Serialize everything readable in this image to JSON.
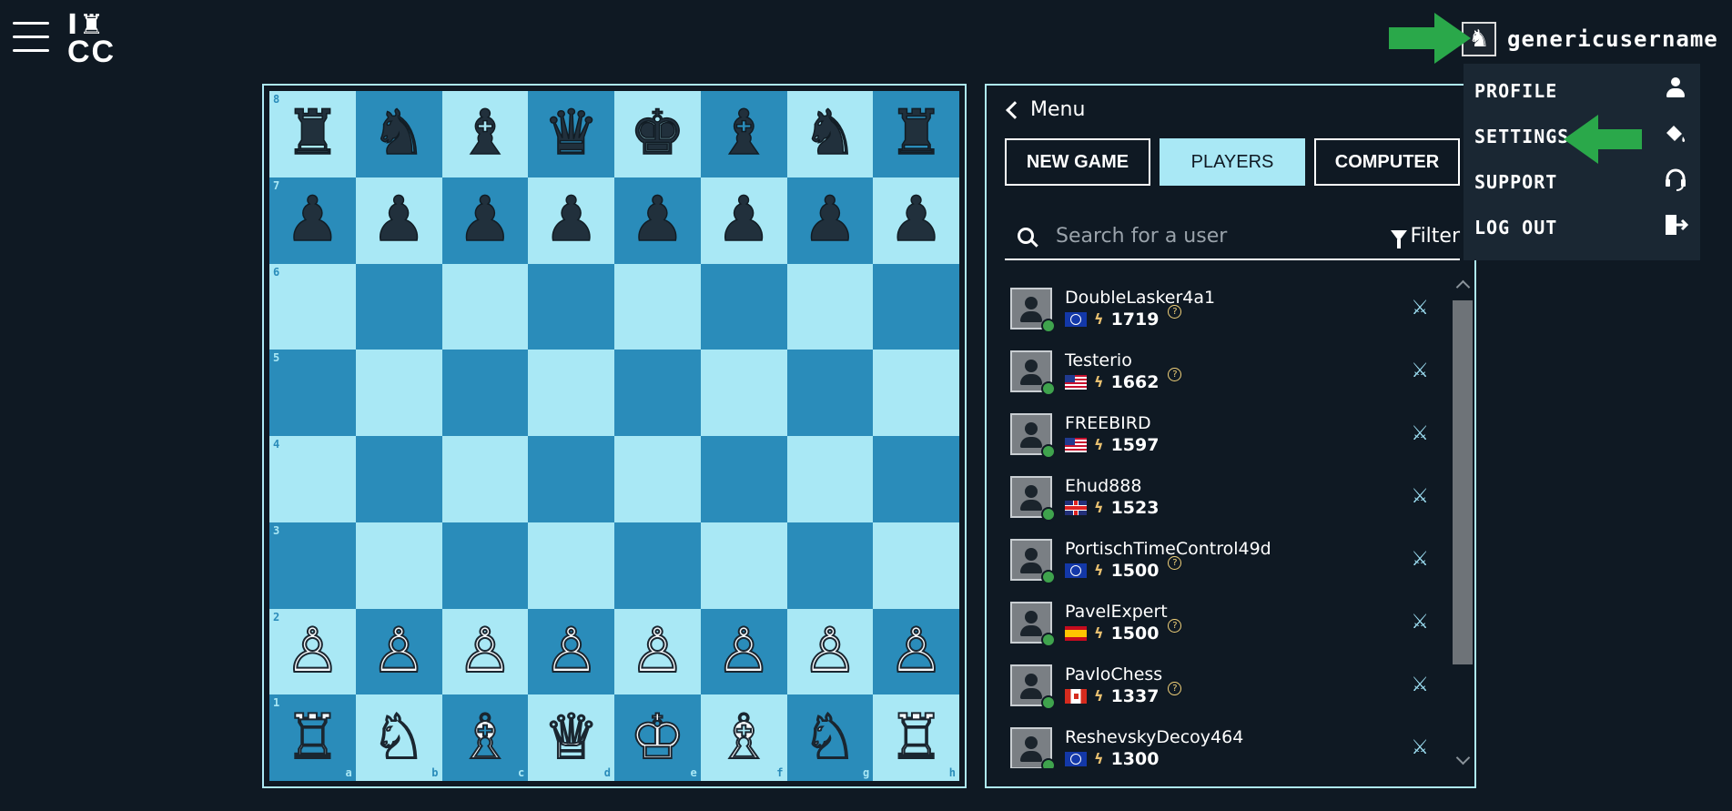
{
  "header": {
    "menu_icon": "hamburger-icon",
    "logo_text_top": "I♜",
    "logo_text_bottom": "CC"
  },
  "user": {
    "name": "genericusername",
    "avatar_icon": "knight-avatar-icon"
  },
  "dropdown": {
    "items": [
      {
        "label": "PROFILE",
        "icon": "person-icon"
      },
      {
        "label": "SETTINGS",
        "icon": "paint-bucket-icon"
      },
      {
        "label": "SUPPORT",
        "icon": "headset-icon"
      },
      {
        "label": "LOG OUT",
        "icon": "logout-icon"
      }
    ]
  },
  "annotation": {
    "arrow_color": "#2aa84a"
  },
  "board": {
    "light_color": "#a9e8f5",
    "dark_color": "#2a8cba",
    "ranks": [
      "8",
      "7",
      "6",
      "5",
      "4",
      "3",
      "2",
      "1"
    ],
    "files": [
      "a",
      "b",
      "c",
      "d",
      "e",
      "f",
      "g",
      "h"
    ],
    "position": [
      [
        "♜",
        "♞",
        "♝",
        "♛",
        "♚",
        "♝",
        "♞",
        "♜"
      ],
      [
        "♟",
        "♟",
        "♟",
        "♟",
        "♟",
        "♟",
        "♟",
        "♟"
      ],
      [
        "",
        "",
        "",
        "",
        "",
        "",
        "",
        ""
      ],
      [
        "",
        "",
        "",
        "",
        "",
        "",
        "",
        ""
      ],
      [
        "",
        "",
        "",
        "",
        "",
        "",
        "",
        ""
      ],
      [
        "",
        "",
        "",
        "",
        "",
        "",
        "",
        ""
      ],
      [
        "♙",
        "♙",
        "♙",
        "♙",
        "♙",
        "♙",
        "♙",
        "♙"
      ],
      [
        "♖",
        "♘",
        "♗",
        "♕",
        "♔",
        "♗",
        "♘",
        "♖"
      ]
    ]
  },
  "panel": {
    "back_label": "Menu",
    "tabs": [
      {
        "label": "NEW GAME",
        "active": false
      },
      {
        "label": "PLAYERS",
        "active": true
      },
      {
        "label": "COMPUTER",
        "active": false
      }
    ],
    "search_placeholder": "Search for a user",
    "filter_label": "Filter",
    "players": [
      {
        "name": "DoubleLasker4a1",
        "flag": "int",
        "rating": "1719",
        "provisional": true
      },
      {
        "name": "Testerio",
        "flag": "us",
        "rating": "1662",
        "provisional": true
      },
      {
        "name": "FREEBIRD",
        "flag": "us",
        "rating": "1597",
        "provisional": false
      },
      {
        "name": "Ehud888",
        "flag": "gb",
        "rating": "1523",
        "provisional": false
      },
      {
        "name": "PortischTimeControl49d",
        "flag": "int",
        "rating": "1500",
        "provisional": true
      },
      {
        "name": "PavelExpert",
        "flag": "es",
        "rating": "1500",
        "provisional": true
      },
      {
        "name": "PavloChess",
        "flag": "ca",
        "rating": "1337",
        "provisional": true
      },
      {
        "name": "ReshevskyDecoy464",
        "flag": "int",
        "rating": "1300",
        "provisional": false
      }
    ]
  }
}
